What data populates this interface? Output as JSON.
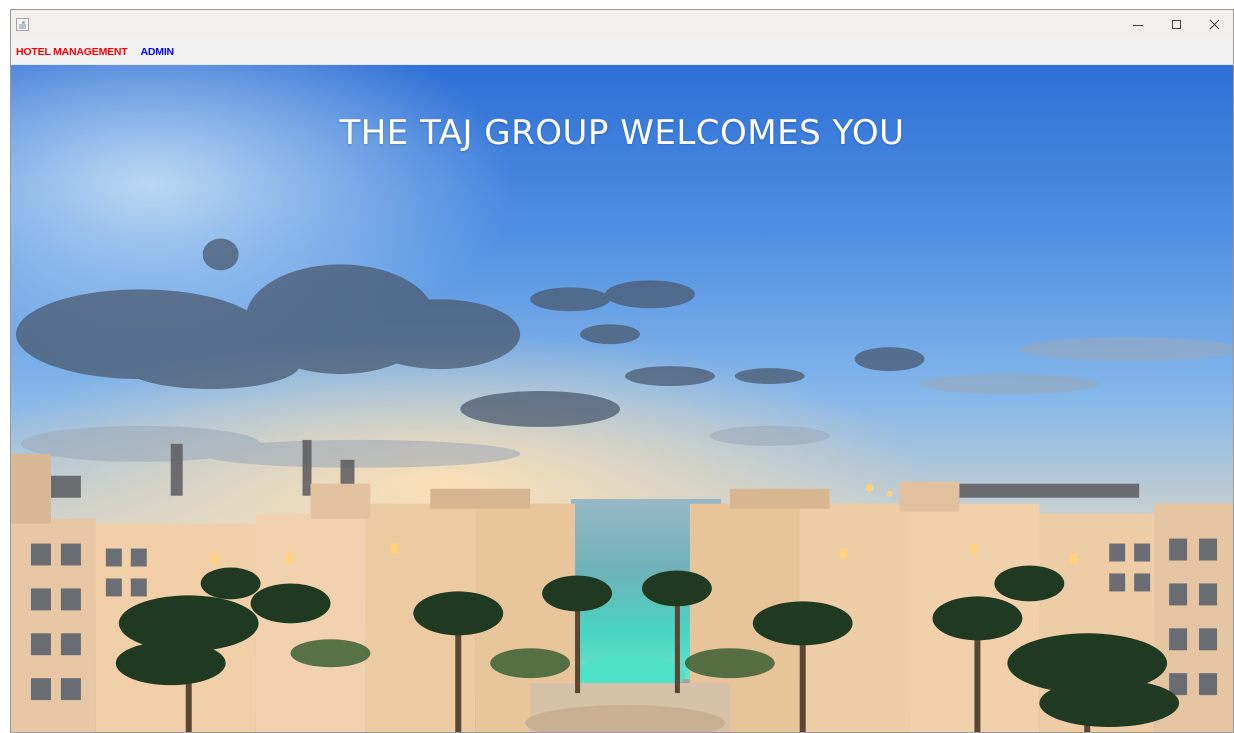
{
  "window": {
    "title": "",
    "controls": {
      "minimize": "minimize-icon",
      "maximize": "maximize-icon",
      "close": "close-icon"
    }
  },
  "menu": {
    "items": [
      {
        "label": "HOTEL MANAGEMENT",
        "color": "#ff0000"
      },
      {
        "label": "ADMIN",
        "color": "#0000ff"
      }
    ]
  },
  "banner": {
    "welcome_text": "THE TAJ GROUP WELCOMES YOU"
  },
  "background": {
    "description_icon": "hotel-resort-photo"
  }
}
